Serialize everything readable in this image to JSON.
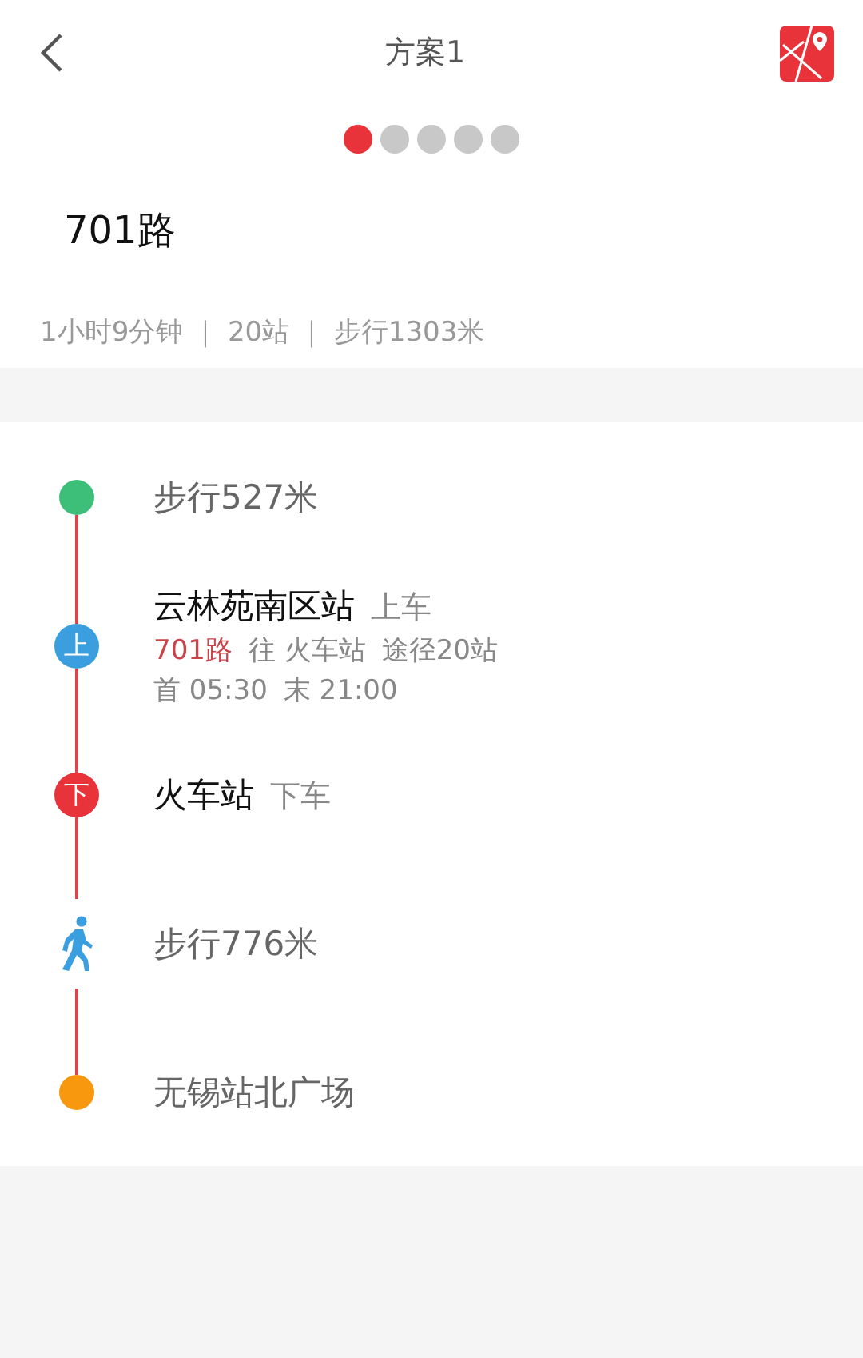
{
  "header": {
    "title": "方案1"
  },
  "pager": [
    {
      "selected": true
    },
    {
      "selected": false
    },
    {
      "selected": false
    },
    {
      "selected": false
    },
    {
      "selected": false
    }
  ],
  "route": {
    "name": "701路",
    "summary": "1小时9分钟 ｜ 20站 ｜ 步行1303米"
  },
  "steps": [
    {
      "kind": "start",
      "color": "#3dbf7a",
      "text": "步行527米"
    },
    {
      "kind": "board",
      "color": "#3b9ede",
      "marker": "上",
      "station": "云林苑南区站",
      "action": "上车",
      "line": "701路",
      "direction": "往 火车站",
      "via": "途径20站",
      "first": "首 05:30",
      "last": "末 21:00"
    },
    {
      "kind": "alight",
      "color": "#e8333a",
      "marker": "下",
      "station": "火车站",
      "action": "下车"
    },
    {
      "kind": "walk",
      "color": "#3b9ede",
      "text": "步行776米"
    },
    {
      "kind": "end",
      "color": "#f7980f",
      "text": "无锡站北广场"
    }
  ]
}
